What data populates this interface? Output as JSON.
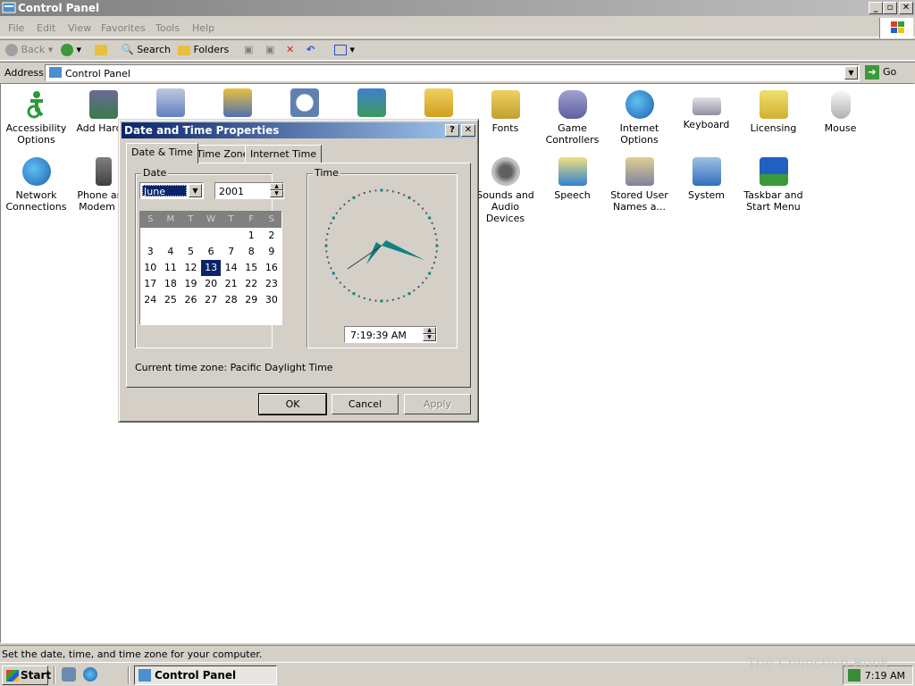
{
  "window": {
    "title": "Control Panel"
  },
  "menu": [
    "File",
    "Edit",
    "View",
    "Favorites",
    "Tools",
    "Help"
  ],
  "toolbar": {
    "back": "Back",
    "search": "Search",
    "folders": "Folders"
  },
  "address": {
    "label": "Address",
    "value": "Control Panel",
    "go": "Go"
  },
  "items": [
    "Accessibility Options",
    "Add Hardw",
    "",
    "",
    "",
    "",
    "",
    "Fonts",
    "Game Controllers",
    "Internet Options",
    "Keyboard",
    "Licensing",
    "Mouse",
    "Network Connections",
    "Phone and Modem ...",
    "Sounds and Audio Devices",
    "Speech",
    "Stored User Names a...",
    "System",
    "Taskbar and Start Menu"
  ],
  "status": "Set the date, time, and time zone for your computer.",
  "taskbar": {
    "start": "Start",
    "task": "Control Panel",
    "clock": "7:19 AM",
    "watermark": "The Collection Book"
  },
  "dialog": {
    "title": "Date and Time Properties",
    "help": "?",
    "tabs": [
      "Date & Time",
      "Time Zone",
      "Internet Time"
    ],
    "date_label": "Date",
    "time_label": "Time",
    "month": "June",
    "year": "2001",
    "weekdays": [
      "S",
      "M",
      "T",
      "W",
      "T",
      "F",
      "S"
    ],
    "days": [
      "",
      "",
      "",
      "",
      "",
      "1",
      "2",
      "3",
      "4",
      "5",
      "6",
      "7",
      "8",
      "9",
      "10",
      "11",
      "12",
      "13",
      "14",
      "15",
      "16",
      "17",
      "18",
      "19",
      "20",
      "21",
      "22",
      "23",
      "24",
      "25",
      "26",
      "27",
      "28",
      "29",
      "30"
    ],
    "selected_day": "13",
    "time": "7:19:39 AM",
    "timezone": "Current time zone:  Pacific Daylight Time",
    "ok": "OK",
    "cancel": "Cancel",
    "apply": "Apply"
  }
}
